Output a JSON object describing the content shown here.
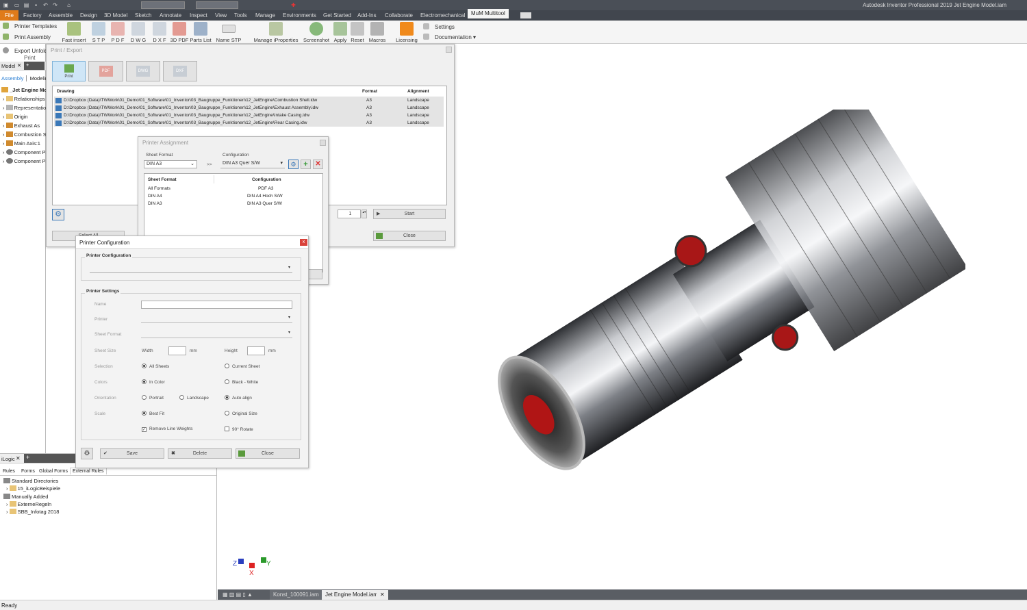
{
  "titlebar": {
    "title": "Autodesk Inventor Professional 2019    Jet Engine Model.iam"
  },
  "menubar": {
    "items": [
      "File",
      "Factory",
      "Assemble",
      "Design",
      "3D Model",
      "Sketch",
      "Annotate",
      "Inspect",
      "View",
      "Tools",
      "Manage",
      "Environments",
      "Get Started",
      "Add-Ins",
      "Collaborate",
      "Electromechanical",
      "MuM Multitool"
    ]
  },
  "ribbon": {
    "left": [
      "Printer Templates",
      "Print Assembly",
      "Export Unfold",
      "Print"
    ],
    "buttons": [
      "Fast insert",
      "S T P",
      "P D F",
      "D W G",
      "D X F",
      "3D PDF",
      "Parts List",
      "Name STP",
      "Manage iProperties",
      "Screenshot",
      "Apply",
      "Reset",
      "Macros",
      "Licensing"
    ],
    "right": [
      "Settings",
      "Documentation"
    ]
  },
  "leftpanel": {
    "tab": "Model",
    "add": "+",
    "subtabs": [
      "Assembly",
      "Modeling"
    ],
    "tree": [
      "_Jet Engine Mo",
      "Relationships",
      "Representation",
      "Origin",
      "Exhaust As",
      "Combustion St",
      "Main Axis:1",
      "Component Pa",
      "Component Pa"
    ]
  },
  "printexport": {
    "title": "Print / Export",
    "tabs": [
      "Print",
      "PDF",
      "DWG",
      "DXF"
    ],
    "headers": {
      "drawing": "Drawing",
      "format": "Format",
      "alignment": "Alignment"
    },
    "rows": [
      {
        "path": "D:\\Dropbox (Data)\\TWWork\\01_Demo\\01_Software\\01_Inventor\\03_Baugruppe_Funktionen\\12_JetEngine\\Combustion Shell.idw",
        "format": "A3",
        "alignment": "Landscape"
      },
      {
        "path": "D:\\Dropbox (Data)\\TWWork\\01_Demo\\01_Software\\01_Inventor\\03_Baugruppe_Funktionen\\12_JetEngine\\Exhaust Assembly.idw",
        "format": "A3",
        "alignment": "Landscape"
      },
      {
        "path": "D:\\Dropbox (Data)\\TWWork\\01_Demo\\01_Software\\01_Inventor\\03_Baugruppe_Funktionen\\12_JetEngine\\Intake Casing.idw",
        "format": "A3",
        "alignment": "Landscape"
      },
      {
        "path": "D:\\Dropbox (Data)\\TWWork\\01_Demo\\01_Software\\01_Inventor\\03_Baugruppe_Funktionen\\12_JetEngine\\Rear Casing.idw",
        "format": "A3",
        "alignment": "Landscape"
      }
    ],
    "copies": "1",
    "start": "Start",
    "close": "Close",
    "selectall": "Select All"
  },
  "printerassign": {
    "title": "Printer Assignment",
    "sheetformat_label": "Sheet Format",
    "sheetformat_value": "DIN A3",
    "arrow": ">>",
    "config_label": "Configuration",
    "config_value": "DIN A3 Quer S/W",
    "headers": {
      "sheet": "Sheet Format",
      "config": "Configuration"
    },
    "rows": [
      {
        "sheet": "All Formats",
        "config": "PDF A3"
      },
      {
        "sheet": "DIN A4",
        "config": "DIN A4 Hoch S/W"
      },
      {
        "sheet": "DIN A3",
        "config": "DIN A3 Quer S/W"
      }
    ]
  },
  "printerconfig": {
    "title": "Printer Configuration",
    "close_x": "x",
    "group1": "Printer Configuration",
    "group2": "Printer Settings",
    "labels": {
      "name": "Name",
      "printer": "Printer",
      "sheetformat": "Sheet Format",
      "sheetsize": "Sheet Size",
      "width": "Width",
      "height": "Height",
      "mm": "mm",
      "selection": "Selection",
      "colors": "Colors",
      "orientation": "Orientation",
      "scale": "Scale"
    },
    "options": {
      "allsheets": "All Sheets",
      "currentsheet": "Current Sheet",
      "incolor": "In Color",
      "bw": "Black - White",
      "portrait": "Portrait",
      "landscape": "Landscape",
      "autoalign": "Auto align",
      "bestfit": "Best Fit",
      "original": "Original Size",
      "removelw": "Remove Line Weights",
      "rotate": "90° Rotate"
    },
    "buttons": {
      "save": "Save",
      "delete": "Delete",
      "close": "Close"
    }
  },
  "logic": {
    "tab": "iLogic",
    "add": "+",
    "subtabs": [
      "Rules",
      "Forms",
      "Global Forms",
      "External Rules"
    ],
    "tree": [
      "Standard Directories",
      "15_iLogicBeispiele",
      "Manually Added",
      "ExterneRegeln",
      "SBB_Infotag 2018"
    ]
  },
  "docbar": {
    "tabs": [
      "Konst_100091.iam",
      "Jet Engine Model.iam"
    ]
  },
  "axes": {
    "z": "Z",
    "y": "Y",
    "x": "X"
  },
  "status": {
    "text": "Ready"
  },
  "colors": {
    "accent": "#e07b1a",
    "chrome": "#41464e",
    "close_red": "#d9413a"
  }
}
